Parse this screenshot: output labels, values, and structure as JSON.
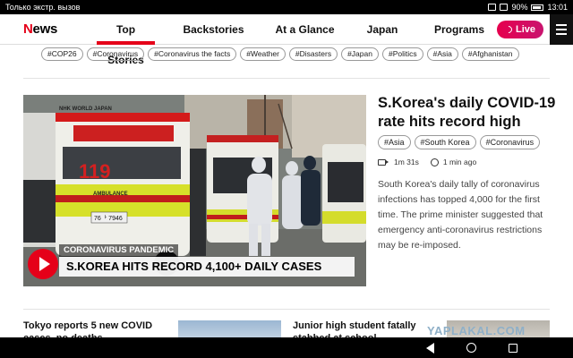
{
  "status_bar": {
    "left_text": "Только экстр. вызов",
    "battery": "90%",
    "time": "13:01"
  },
  "header": {
    "logo_prefix": "N",
    "logo_suffix": "ews",
    "nav": [
      {
        "label": "Top Stories",
        "active": true
      },
      {
        "label": "Backstories",
        "active": false
      },
      {
        "label": "At a Glance",
        "active": false
      },
      {
        "label": "Japan",
        "active": false
      },
      {
        "label": "Programs",
        "active": false
      }
    ],
    "live_label": "Live"
  },
  "tag_row": [
    "#COP26",
    "#Coronavirus",
    "#Coronavirus the facts",
    "#Weather",
    "#Disasters",
    "#Japan",
    "#Politics",
    "#Asia",
    "#Afghanistan"
  ],
  "main_story": {
    "headline": "S.Korea's daily COVID-19 rate hits record high",
    "tags": [
      "#Asia",
      "#South Korea",
      "#Coronavirus"
    ],
    "duration": "1m 31s",
    "time_ago": "1 min ago",
    "summary": "South Korea's daily tally of coronavirus infections has topped 4,000 for the first time. The prime minister suggested that emergency anti-coronavirus restrictions may be re-imposed.",
    "image_banner_top": "CORONAVIRUS PANDEMIC",
    "image_banner_main": "S.KOREA HITS RECORD 4,100+ DAILY CASES",
    "image_text_top": "NHK WORLD JAPAN",
    "ambulance_number": "119",
    "ambulance_label": "AMBULANCE",
    "plate": "76ᅡ 7946"
  },
  "bottom_cards": [
    {
      "title": "Tokyo reports 5 new COVID cases, no deaths"
    },
    {
      "title": "Junior high student fatally stabbed at school"
    }
  ],
  "watermark": "YAPLAKAL.COM"
}
